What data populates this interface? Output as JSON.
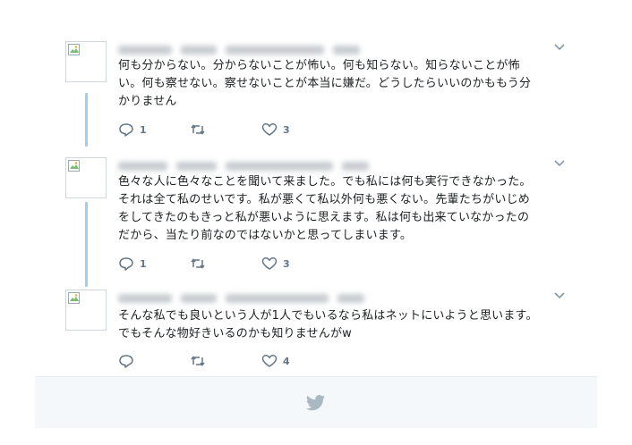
{
  "tweets": [
    {
      "text": "何も分からない。分からないことが怖い。何も知らない。知らないことが怖\nい。何も察せない。察せないことが本当に嫌だ。どうしたらいいのかももう分\nかりません",
      "reply_count": "1",
      "retweet_count": "",
      "like_count": "3"
    },
    {
      "text": "色々な人に色々なことを聞いて来ました。でも私には何も実行できなかった。\nそれは全て私のせいです。私が悪くて私以外何も悪くない。先輩たちがいじめ\nをしてきたのもきっと私が悪いように思えます。私は何も出来ていなかったの\nだから、当たり前なのではないかと思ってしまいます。",
      "reply_count": "1",
      "retweet_count": "",
      "like_count": "3"
    },
    {
      "text": "そんな私でも良いという人が1人でもいるなら私はネットにいようと思います。\nでもそんな物好きいるのかも知りませんがw",
      "reply_count": "",
      "retweet_count": "",
      "like_count": "4"
    }
  ],
  "icons": {
    "reply": "reply-icon",
    "retweet": "retweet-icon",
    "like": "heart-icon",
    "caret": "chevron-down-icon",
    "footer": "twitter-bird-icon"
  },
  "colors": {
    "thread_line": "#9ccfec",
    "icon_gray": "#657786",
    "footer_bg": "#f5f8fa",
    "bird": "#aab8c2"
  }
}
